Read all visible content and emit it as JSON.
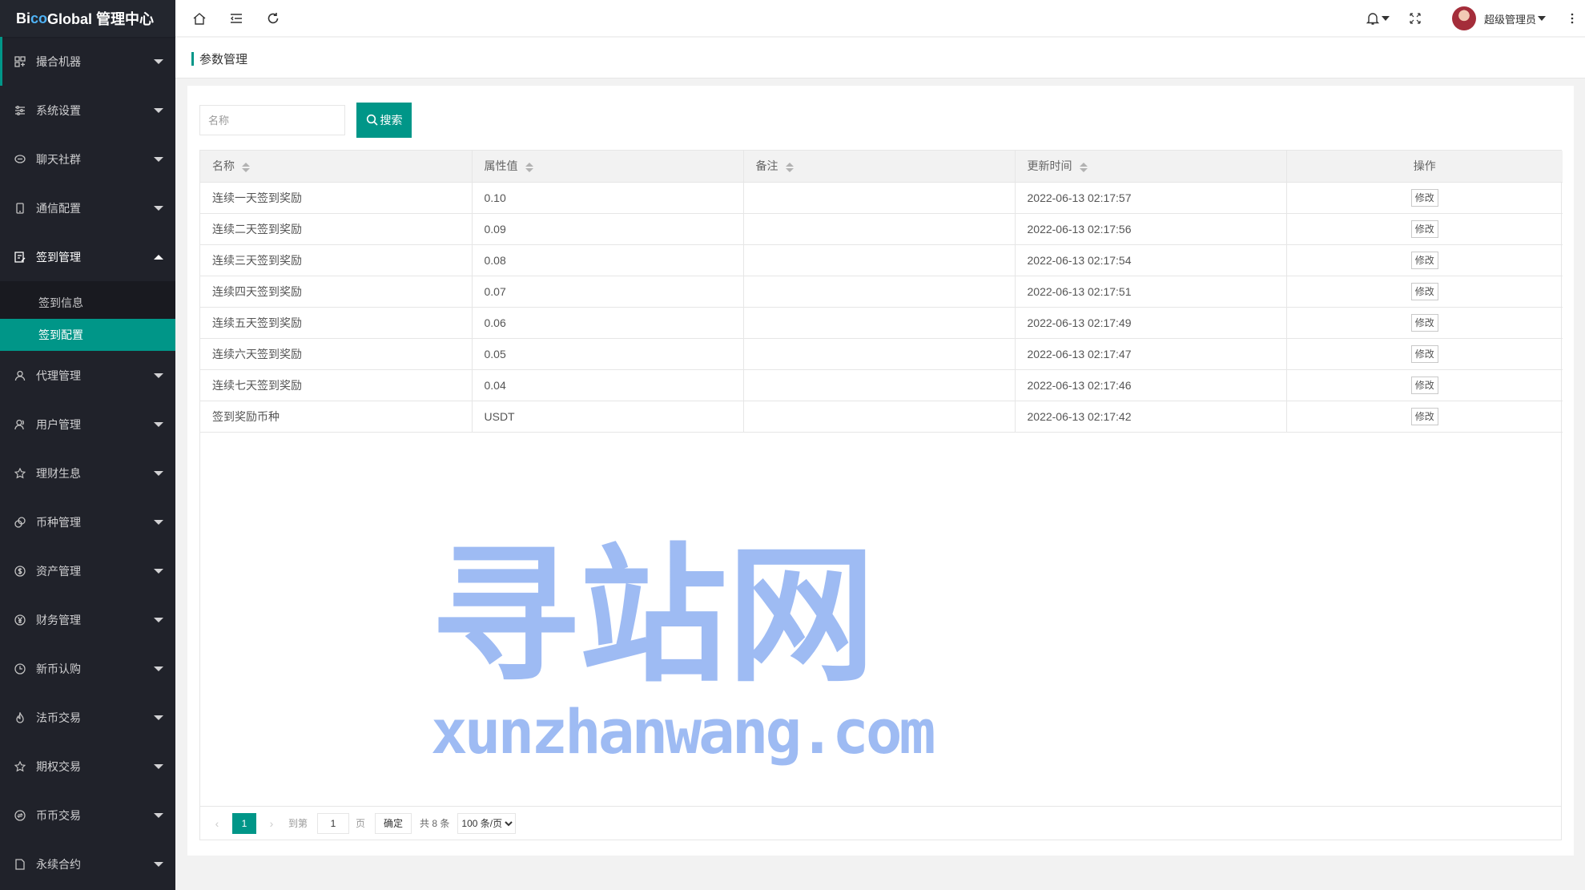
{
  "app": {
    "brand_prefix": "Bi",
    "brand_accent": "co",
    "brand_suffix": " Global 管理中心"
  },
  "sidebar": {
    "items": [
      {
        "label": "撮合机器",
        "icon": "robot-icon"
      },
      {
        "label": "系统设置",
        "icon": "sliders-icon"
      },
      {
        "label": "聊天社群",
        "icon": "chat-icon"
      },
      {
        "label": "通信配置",
        "icon": "phone-icon"
      },
      {
        "label": "签到管理",
        "icon": "checkin-icon",
        "open": true
      },
      {
        "label": "代理管理",
        "icon": "user-icon"
      },
      {
        "label": "用户管理",
        "icon": "users-icon"
      },
      {
        "label": "理财生息",
        "icon": "star-icon"
      },
      {
        "label": "币种管理",
        "icon": "coin-icon"
      },
      {
        "label": "资产管理",
        "icon": "dollar-icon"
      },
      {
        "label": "财务管理",
        "icon": "yen-icon"
      },
      {
        "label": "新币认购",
        "icon": "clock-icon"
      },
      {
        "label": "法币交易",
        "icon": "fire-icon"
      },
      {
        "label": "期权交易",
        "icon": "star-icon"
      },
      {
        "label": "币币交易",
        "icon": "exchange-icon"
      },
      {
        "label": "永续合约",
        "icon": "file-icon"
      }
    ],
    "sub_items": [
      {
        "label": "签到信息"
      },
      {
        "label": "签到配置",
        "active": true
      }
    ]
  },
  "header": {
    "user_name": "超级管理员"
  },
  "page": {
    "title": "参数管理"
  },
  "search": {
    "placeholder": "名称",
    "value": "",
    "button_label": "搜索"
  },
  "table": {
    "columns": [
      "名称",
      "属性值",
      "备注",
      "更新时间",
      "操作"
    ],
    "rows": [
      {
        "name": "连续一天签到奖励",
        "value": "0.10",
        "remark": "",
        "updated": "2022-06-13 02:17:57"
      },
      {
        "name": "连续二天签到奖励",
        "value": "0.09",
        "remark": "",
        "updated": "2022-06-13 02:17:56"
      },
      {
        "name": "连续三天签到奖励",
        "value": "0.08",
        "remark": "",
        "updated": "2022-06-13 02:17:54"
      },
      {
        "name": "连续四天签到奖励",
        "value": "0.07",
        "remark": "",
        "updated": "2022-06-13 02:17:51"
      },
      {
        "name": "连续五天签到奖励",
        "value": "0.06",
        "remark": "",
        "updated": "2022-06-13 02:17:49"
      },
      {
        "name": "连续六天签到奖励",
        "value": "0.05",
        "remark": "",
        "updated": "2022-06-13 02:17:47"
      },
      {
        "name": "连续七天签到奖励",
        "value": "0.04",
        "remark": "",
        "updated": "2022-06-13 02:17:46"
      },
      {
        "name": "签到奖励币种",
        "value": "USDT",
        "remark": "",
        "updated": "2022-06-13 02:17:42"
      }
    ],
    "edit_label": "修改"
  },
  "pager": {
    "current_page": "1",
    "goto_prefix": "到第",
    "goto_value": "1",
    "goto_suffix": "页",
    "confirm_label": "确定",
    "total_text": "共 8 条",
    "page_size": "100 条/页"
  },
  "watermark": {
    "cn": "寻站网",
    "en": "xunzhanwang.com"
  },
  "colors": {
    "accent": "#009688",
    "sidebar_bg": "#20222a",
    "brand_accent": "#4fb3f6"
  }
}
